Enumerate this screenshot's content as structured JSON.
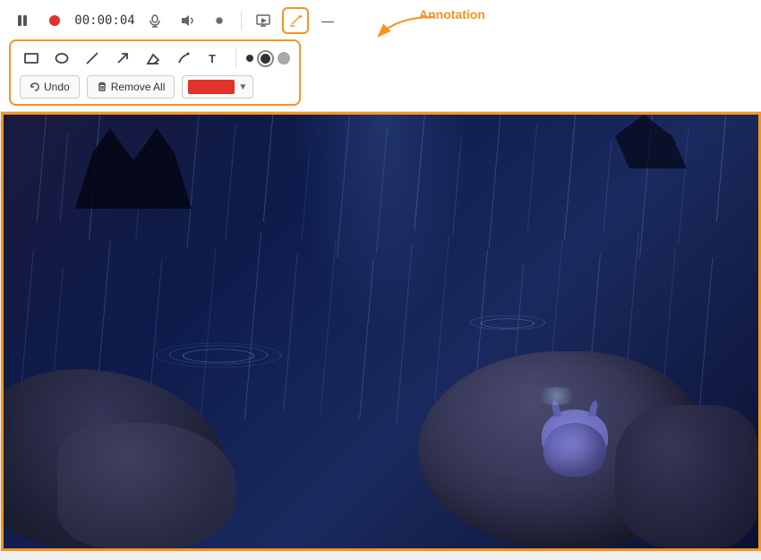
{
  "header": {
    "timestamp": "00:00:04"
  },
  "toolbar": {
    "pause_icon": "⏸",
    "record_icon": "⏺",
    "mic_icon": "🎙",
    "volume_icon": "🔊",
    "camera_icon": "🎤",
    "screen_icon": "🖼",
    "annotation_icon": "✏",
    "minus_icon": "—"
  },
  "annotation_panel": {
    "tools": [
      {
        "name": "rectangle",
        "icon": "□"
      },
      {
        "name": "ellipse",
        "icon": "○"
      },
      {
        "name": "line",
        "icon": "/"
      },
      {
        "name": "arrow",
        "icon": "↗"
      },
      {
        "name": "eraser",
        "icon": "◇"
      },
      {
        "name": "pen",
        "icon": "✏"
      },
      {
        "name": "text",
        "icon": "T"
      }
    ],
    "brush_sizes": [
      {
        "name": "small",
        "active": false
      },
      {
        "name": "medium",
        "active": true
      },
      {
        "name": "large",
        "active": false
      }
    ],
    "undo_label": "Undo",
    "remove_all_label": "Remove All",
    "selected_color": "#e0342a"
  },
  "annotation_callout": {
    "label": "Annotation"
  }
}
